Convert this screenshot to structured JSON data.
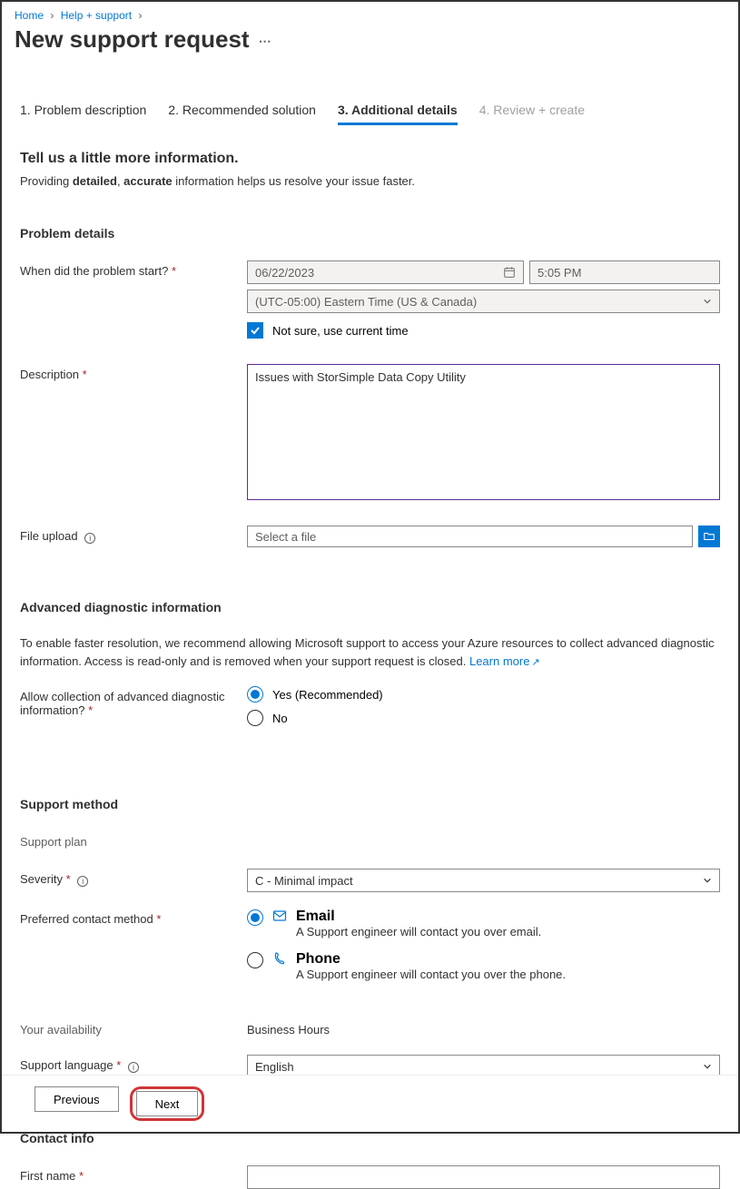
{
  "breadcrumb": {
    "home": "Home",
    "help": "Help + support"
  },
  "page_title": "New support request",
  "tabs": [
    {
      "label": "1. Problem description",
      "active": false,
      "disabled": false
    },
    {
      "label": "2. Recommended solution",
      "active": false,
      "disabled": false
    },
    {
      "label": "3. Additional details",
      "active": true,
      "disabled": false
    },
    {
      "label": "4. Review + create",
      "active": false,
      "disabled": true
    }
  ],
  "intro": {
    "heading": "Tell us a little more information.",
    "text_pre": "Providing ",
    "strong1": "detailed",
    "sep": ", ",
    "strong2": "accurate",
    "text_post": " information helps us resolve your issue faster."
  },
  "sections": {
    "problem_details": "Problem details",
    "advanced_diag": "Advanced diagnostic information",
    "support_method": "Support method",
    "contact_info": "Contact info"
  },
  "labels": {
    "when_start": "When did the problem start?",
    "description": "Description",
    "file_upload": "File upload",
    "allow_diag": "Allow collection of advanced diagnostic information?",
    "support_plan": "Support plan",
    "severity": "Severity",
    "pref_contact": "Preferred contact method",
    "availability": "Your availability",
    "support_lang": "Support language",
    "first_name": "First name"
  },
  "values": {
    "date": "06/22/2023",
    "time": "5:05 PM",
    "timezone": "(UTC-05:00) Eastern Time (US & Canada)",
    "use_current_time": "Not sure, use current time",
    "description": "Issues with StorSimple Data Copy Utility",
    "file_placeholder": "Select a file",
    "severity": "C - Minimal impact",
    "availability": "Business Hours",
    "language": "English"
  },
  "diag": {
    "text": "To enable faster resolution, we recommend allowing Microsoft support to access your Azure resources to collect advanced diagnostic information. Access is read-only and is removed when your support request is closed. ",
    "learn_more": "Learn more",
    "yes": "Yes (Recommended)",
    "no": "No"
  },
  "contact_methods": {
    "email_label": "Email",
    "email_sub": "A Support engineer will contact you over email.",
    "phone_label": "Phone",
    "phone_sub": "A Support engineer will contact you over the phone."
  },
  "buttons": {
    "previous": "Previous",
    "next": "Next"
  }
}
